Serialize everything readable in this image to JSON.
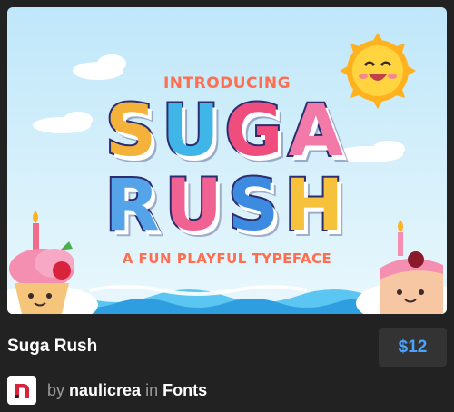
{
  "preview": {
    "intro": "INTRODUCING",
    "word1": [
      "S",
      "U",
      "G",
      "A"
    ],
    "word2": [
      "R",
      "U",
      "S",
      "H"
    ],
    "tagline": "A FUN PLAYFUL TYPEFACE"
  },
  "product": {
    "title": "Suga Rush",
    "price": "$12"
  },
  "author": {
    "by": "by",
    "name": "naulicrea",
    "in": "in",
    "category": "Fonts"
  },
  "colors": {
    "background": "#222222",
    "price": "#4aa3ff",
    "accent_orange": "#ff6e4f",
    "sky": "#bfe7fa"
  },
  "icons": {
    "sun": "sun-mascot-icon",
    "cupcake": "cupcake-icon",
    "cake": "cake-slice-icon",
    "avatar": "author-logo-icon"
  }
}
